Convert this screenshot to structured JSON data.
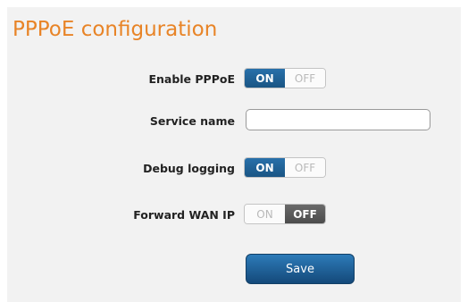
{
  "page": {
    "title": "PPPoE configuration",
    "accent_color": "#e88427"
  },
  "fields": {
    "enable_pppoe": {
      "label": "Enable PPPoE",
      "on_label": "ON",
      "off_label": "OFF",
      "state": "ON"
    },
    "service_name": {
      "label": "Service name",
      "value": "",
      "placeholder": ""
    },
    "debug_logging": {
      "label": "Debug logging",
      "on_label": "ON",
      "off_label": "OFF",
      "state": "ON"
    },
    "forward_wan_ip": {
      "label": "Forward WAN IP",
      "on_label": "ON",
      "off_label": "OFF",
      "state": "OFF"
    }
  },
  "actions": {
    "save_label": "Save"
  }
}
